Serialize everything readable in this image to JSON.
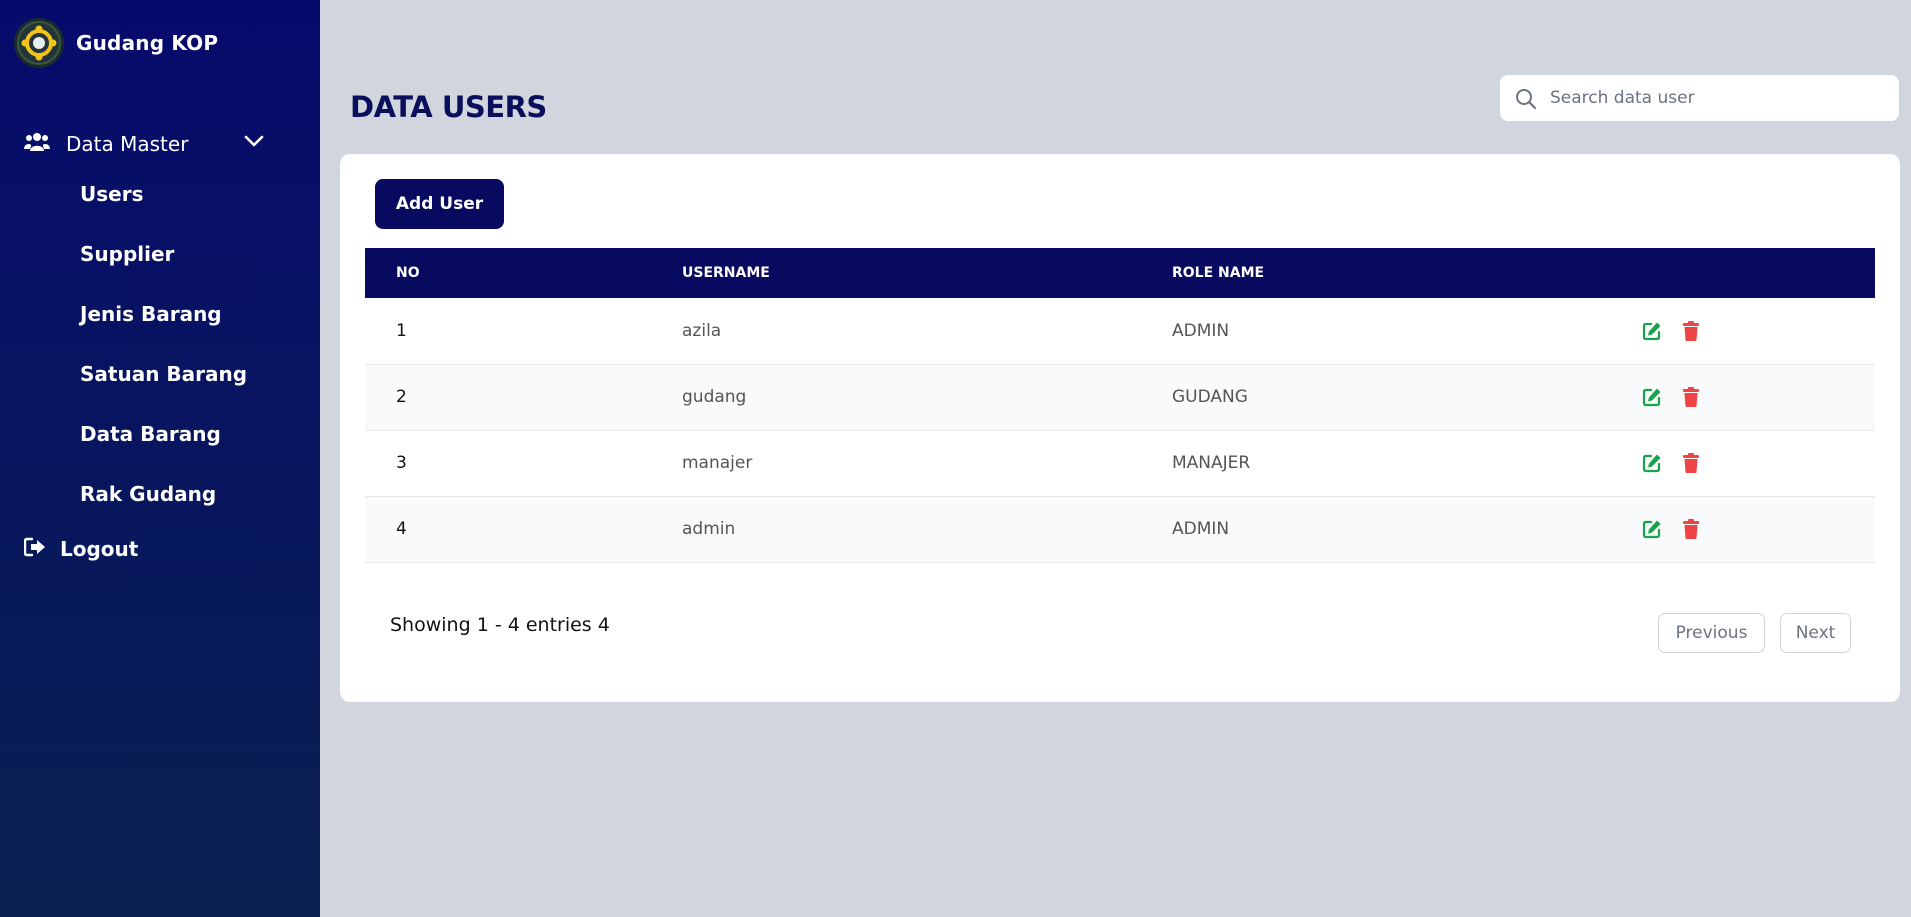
{
  "app": {
    "name": "Gudang KOP"
  },
  "sidebar": {
    "group": {
      "label": "Data Master",
      "icon": "users-icon"
    },
    "items": [
      {
        "label": "Users"
      },
      {
        "label": "Supplier"
      },
      {
        "label": "Jenis Barang"
      },
      {
        "label": "Satuan Barang"
      },
      {
        "label": "Data Barang"
      },
      {
        "label": "Rak Gudang"
      }
    ],
    "logout": {
      "label": "Logout",
      "icon": "sign-out-icon"
    }
  },
  "header": {
    "title": "DATA USERS",
    "search": {
      "placeholder": "Search data user",
      "value": ""
    }
  },
  "toolbar": {
    "add_label": "Add User"
  },
  "table": {
    "columns": [
      "NO",
      "USERNAME",
      "ROLE NAME",
      ""
    ],
    "rows": [
      {
        "no": "1",
        "username": "azila",
        "role": "ADMIN"
      },
      {
        "no": "2",
        "username": "gudang",
        "role": "GUDANG"
      },
      {
        "no": "3",
        "username": "manajer",
        "role": "MANAJER"
      },
      {
        "no": "4",
        "username": "admin",
        "role": "ADMIN"
      }
    ]
  },
  "pagination": {
    "summary": "Showing 1 - 4 entries 4",
    "previous": "Previous",
    "next": "Next"
  },
  "colors": {
    "sidebar": "#070a6c",
    "accent": "#070a5e",
    "edit": "#16a34a",
    "delete": "#ef4444",
    "background": "#d1d5de"
  }
}
